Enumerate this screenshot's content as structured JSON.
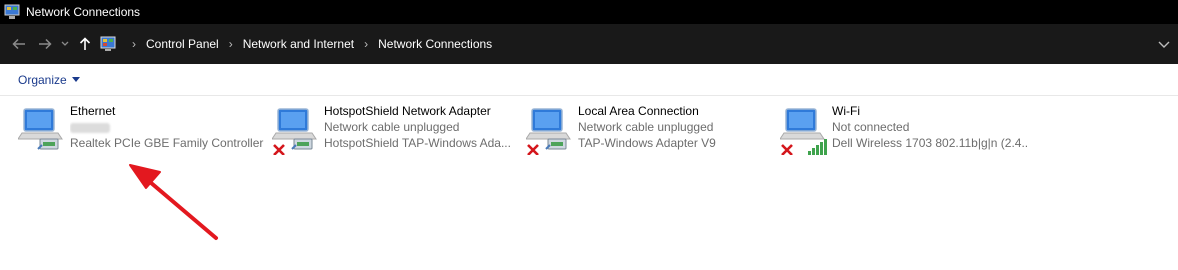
{
  "window": {
    "title": "Network Connections"
  },
  "breadcrumb": [
    "Control Panel",
    "Network and Internet",
    "Network Connections"
  ],
  "toolbar": {
    "organize_label": "Organize"
  },
  "connections": [
    {
      "name": "Ethernet",
      "status": "",
      "device": "Realtek PCIe GBE Family Controller",
      "disconnected": false,
      "type": "wired"
    },
    {
      "name": "HotspotShield Network Adapter",
      "status": "Network cable unplugged",
      "device": "HotspotShield TAP-Windows Ada...",
      "disconnected": true,
      "type": "wired"
    },
    {
      "name": "Local Area Connection",
      "status": "Network cable unplugged",
      "device": "TAP-Windows Adapter V9",
      "disconnected": true,
      "type": "wired"
    },
    {
      "name": "Wi-Fi",
      "status": "Not connected",
      "device": "Dell Wireless 1703 802.11b|g|n (2.4...",
      "disconnected": true,
      "type": "wireless"
    }
  ],
  "colors": {
    "titlebar": "#000000",
    "addressbar": "#191919",
    "organize": "#1a3a8c",
    "annotation_arrow": "#e3181f",
    "disconnect_x": "#d4161c"
  }
}
